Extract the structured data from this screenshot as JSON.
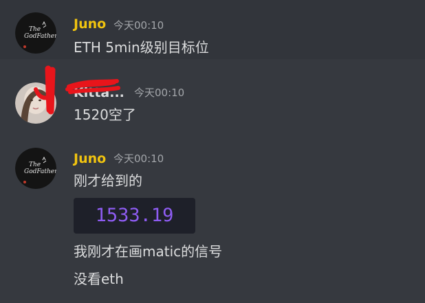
{
  "colors": {
    "background": "#36393f",
    "highlight_row": "#32353b",
    "username_juno": "#f1c40f",
    "timestamp": "#a3a6aa",
    "message_text": "#dcddde",
    "price_embed_bg": "#1e2029",
    "price_text": "#8e5cf2",
    "redaction": "#e8151b"
  },
  "messages": [
    {
      "username": "Juno",
      "timestamp": "今天00:10",
      "avatar_icon": "godfather-logo-avatar",
      "lines": [
        "ETH 5min级别目标位"
      ]
    },
    {
      "username": "Kitta...",
      "timestamp": "今天00:10",
      "avatar_icon": "user-photo-avatar",
      "lines": [
        "1520空了"
      ]
    },
    {
      "username": "Juno",
      "timestamp": "今天00:10",
      "avatar_icon": "godfather-logo-avatar",
      "lines": [
        "刚才给到的",
        "我刚才在画matic的信号",
        "没看eth"
      ],
      "price_embed": "1533.19"
    }
  ],
  "logo_text": "The GodFather"
}
